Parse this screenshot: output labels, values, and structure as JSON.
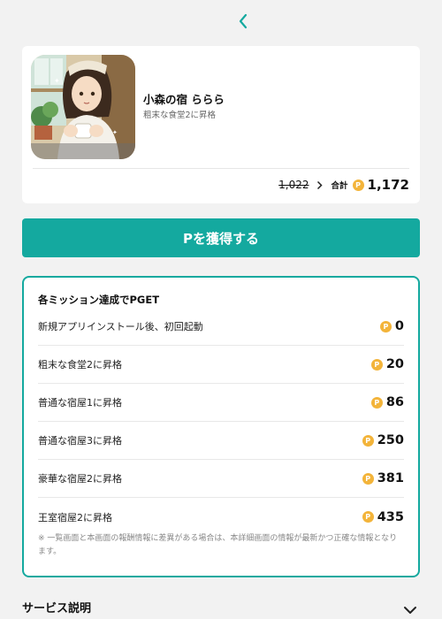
{
  "header": {
    "back_icon": "chevron-left-icon"
  },
  "app": {
    "name": "小森の宿 ららら",
    "description": "粗末な食堂2に昇格"
  },
  "points": {
    "old": "1,022",
    "total_label": "合計",
    "total": "1,172",
    "coin_symbol": "P"
  },
  "cta": {
    "label": "Pを獲得する"
  },
  "missions": {
    "title": "各ミッション達成でPGET",
    "items": [
      {
        "label": "新規アプリインストール後、初回起動",
        "points": "0"
      },
      {
        "label": "粗末な食堂2に昇格",
        "points": "20"
      },
      {
        "label": "普通な宿屋1に昇格",
        "points": "86"
      },
      {
        "label": "普通な宿屋3に昇格",
        "points": "250"
      },
      {
        "label": "豪華な宿屋2に昇格",
        "points": "381"
      },
      {
        "label": "王室宿屋2に昇格",
        "points": "435"
      }
    ],
    "note": "※ 一覧画面と本画面の報酬情報に差異がある場合は、本詳細画面の情報が最新かつ正確な情報となります。"
  },
  "service": {
    "title": "サービス説明"
  },
  "colors": {
    "accent": "#14a99f",
    "coin": "#f3b43a",
    "background": "#f2f2f2"
  }
}
